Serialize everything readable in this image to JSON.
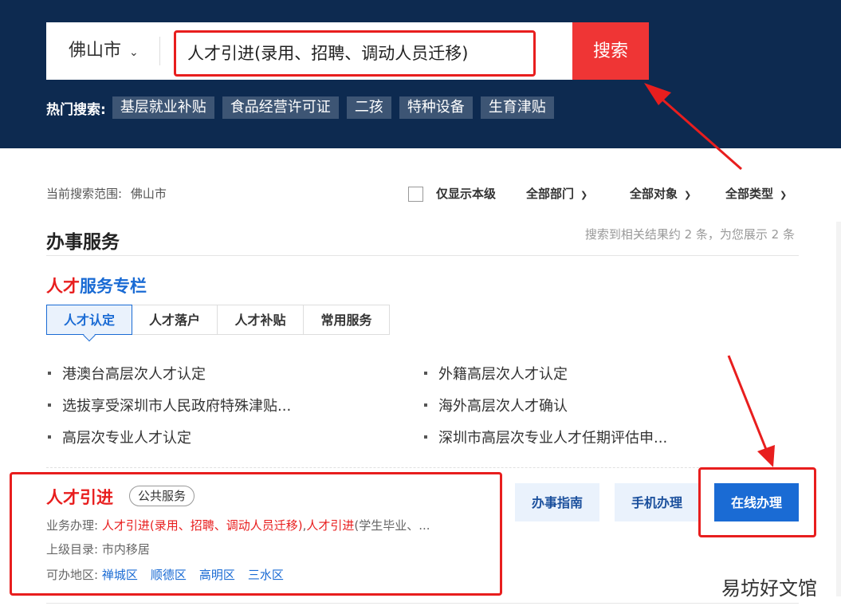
{
  "search": {
    "city": "佛山市",
    "query": "人才引进(录用、招聘、调动人员迁移)",
    "button_label": "搜索"
  },
  "hot": {
    "label": "热门搜索:",
    "tags": [
      "基层就业补贴",
      "食品经营许可证",
      "二孩",
      "特种设备",
      "生育津贴"
    ]
  },
  "filters": {
    "scope_label": "当前搜索范围:",
    "scope_value": "佛山市",
    "only_level": "仅显示本级",
    "dept": "全部部门",
    "target": "全部对象",
    "type": "全部类型"
  },
  "section": {
    "title": "办事服务",
    "result_count": "搜索到相关结果约 2 条，为您展示 2 条"
  },
  "column": {
    "title_red": "人才",
    "title_blue": "服务专栏",
    "tabs": [
      "人才认定",
      "人才落户",
      "人才补贴",
      "常用服务"
    ],
    "items_left": [
      "港澳台高层次人才认定",
      "选拔享受深圳市人民政府特殊津贴...",
      "高层次专业人才认定"
    ],
    "items_right": [
      "外籍高层次人才认定",
      "海外高层次人才确认",
      "深圳市高层次专业人才任期评估申..."
    ]
  },
  "result": {
    "title": "人才引进",
    "badge": "公共服务",
    "business_label": "业务办理:",
    "business_red1": "人才引进(录用、招聘、调动人员迁移)",
    "business_sep": ",",
    "business_red2": "人才引进",
    "business_rest": "(学生毕业、...",
    "parent_label": "上级目录:",
    "parent_value": "市内移居",
    "area_label": "可办地区:",
    "areas": [
      "禅城区",
      "顺德区",
      "高明区",
      "三水区"
    ],
    "btn_guide": "办事指南",
    "btn_mobile": "手机办理",
    "btn_online": "在线办理"
  },
  "watermark": "易坊好文馆",
  "colors": {
    "header_bg": "#0d2a50",
    "accent_red": "#ef3535",
    "link_blue": "#1a6bd4"
  }
}
